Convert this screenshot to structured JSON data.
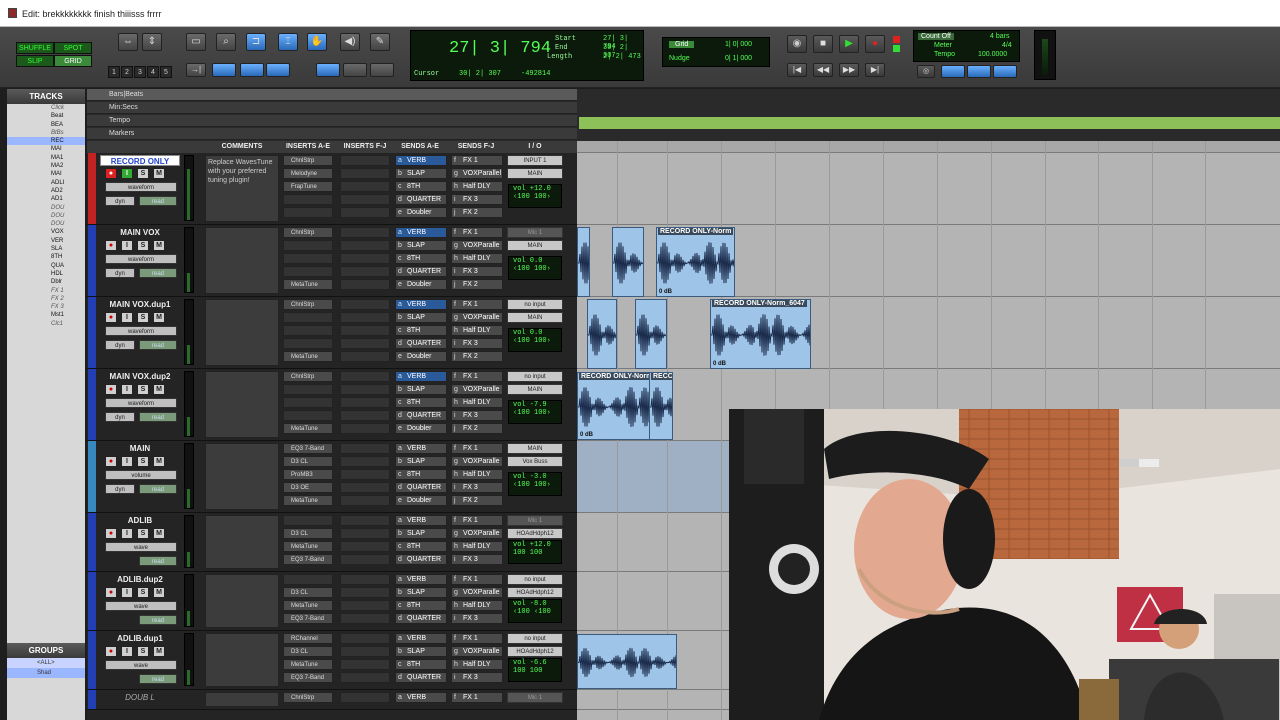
{
  "window": {
    "title": "Edit: brekkkkkkkk finish thiiisss frrrr"
  },
  "edit_modes": [
    "SHUFFLE",
    "SPOT",
    "SLIP",
    "GRID"
  ],
  "zoom_presets": [
    "1",
    "2",
    "3",
    "4",
    "5"
  ],
  "counter": {
    "main": "27| 3| 794",
    "start_label": "Start",
    "start": "27| 3| 794",
    "end_label": "End",
    "end": "30| 2| 307",
    "length_label": "Length",
    "length": "2| 2| 473",
    "cursor_label": "Cursor",
    "cursor": "30| 2| 307",
    "cursor_val2": "-492814"
  },
  "grid": {
    "label": "Grid",
    "value": "1| 0| 000",
    "nudge_label": "Nudge",
    "nudge_value": "0| 1| 000"
  },
  "meter": {
    "count_off": "Count Off",
    "count_bars": "4 bars",
    "meter_label": "Meter",
    "meter": "4/4",
    "tempo_label": "Tempo",
    "tempo": "100.0000"
  },
  "tracks_panel": {
    "title": "TRACKS",
    "items": [
      "Click",
      "Beat",
      "BEA",
      "BtBs",
      "REC",
      "MAI",
      "MA1",
      "MA2",
      "MAI",
      "ADLI",
      "AD2",
      "AD1",
      "DOU",
      "DOU",
      "DOU",
      "VOX",
      "VER",
      "SLA",
      "8TH",
      "QUA",
      "HDL",
      "Dblr",
      "FX 1",
      "FX 2",
      "FX 3",
      "Mst1",
      "Clc1"
    ]
  },
  "groups_panel": {
    "title": "GROUPS",
    "items": [
      "<ALL>",
      "Shad"
    ]
  },
  "rulers": [
    "Bars|Beats",
    "Min:Secs",
    "Tempo",
    "Markers"
  ],
  "mix_columns": [
    "COMMENTS",
    "INSERTS A-E",
    "INSERTS F-J",
    "SENDS A-E",
    "SENDS F-J",
    "I / O"
  ],
  "tracks": [
    {
      "name": "RECORD ONLY",
      "mode": "waveform",
      "sub": "dyn",
      "auto": "read",
      "comment": "Replace WavesTune with your preferred tuning plugin!",
      "inserts": [
        "ChnlStrp",
        "Melodyne",
        "FrapTune",
        "",
        ""
      ],
      "sends_a": [
        [
          "a",
          "VERB"
        ],
        [
          "b",
          "SLAP"
        ],
        [
          "c",
          "8TH"
        ],
        [
          "d",
          "QUARTER"
        ],
        [
          "e",
          "Doubler"
        ]
      ],
      "sends_f": [
        [
          "f",
          "FX 1"
        ],
        [
          "g",
          "VOXParallel"
        ],
        [
          "h",
          "Half DLY"
        ],
        [
          "i",
          "FX 3"
        ],
        [
          "j",
          "FX 2"
        ]
      ],
      "input": "INPUT 1",
      "output": "MAIN",
      "vol": "vol   +12.0",
      "pan": "‹100  100›"
    },
    {
      "name": "MAIN VOX",
      "mode": "waveform",
      "sub": "dyn",
      "auto": "read",
      "comment": "",
      "inserts": [
        "ChnlStrp",
        "",
        "",
        "",
        "MetaTune"
      ],
      "sends_a": [
        [
          "a",
          "VERB"
        ],
        [
          "b",
          "SLAP"
        ],
        [
          "c",
          "8TH"
        ],
        [
          "d",
          "QUARTER"
        ],
        [
          "e",
          "Doubler"
        ]
      ],
      "sends_f": [
        [
          "f",
          "FX 1"
        ],
        [
          "g",
          "VOXParalle"
        ],
        [
          "h",
          "Half DLY"
        ],
        [
          "i",
          "FX 3"
        ],
        [
          "j",
          "FX 2"
        ]
      ],
      "input": "Mic 1",
      "output": "MAIN",
      "vol": "vol    0.0",
      "pan": "‹100  100›"
    },
    {
      "name": "MAIN VOX.dup1",
      "mode": "waveform",
      "sub": "dyn",
      "auto": "read",
      "comment": "",
      "inserts": [
        "ChnlStrp",
        "",
        "",
        "",
        "MetaTune"
      ],
      "sends_a": [
        [
          "a",
          "VERB"
        ],
        [
          "b",
          "SLAP"
        ],
        [
          "c",
          "8TH"
        ],
        [
          "d",
          "QUARTER"
        ],
        [
          "e",
          "Doubler"
        ]
      ],
      "sends_f": [
        [
          "f",
          "FX 1"
        ],
        [
          "g",
          "VOXParalle"
        ],
        [
          "h",
          "Half DLY"
        ],
        [
          "i",
          "FX 3"
        ],
        [
          "j",
          "FX 2"
        ]
      ],
      "input": "no input",
      "output": "MAIN",
      "vol": "vol    0.0",
      "pan": "‹100  100›"
    },
    {
      "name": "MAIN VOX.dup2",
      "mode": "waveform",
      "sub": "dyn",
      "auto": "read",
      "comment": "",
      "inserts": [
        "ChnlStrp",
        "",
        "",
        "",
        "MetaTune"
      ],
      "sends_a": [
        [
          "a",
          "VERB"
        ],
        [
          "b",
          "SLAP"
        ],
        [
          "c",
          "8TH"
        ],
        [
          "d",
          "QUARTER"
        ],
        [
          "e",
          "Doubler"
        ]
      ],
      "sends_f": [
        [
          "f",
          "FX 1"
        ],
        [
          "g",
          "VOXParalle"
        ],
        [
          "h",
          "Half DLY"
        ],
        [
          "i",
          "FX 3"
        ],
        [
          "j",
          "FX 2"
        ]
      ],
      "input": "no input",
      "output": "MAIN",
      "vol": "vol   -7.9",
      "pan": "‹100  100›"
    },
    {
      "name": "MAIN",
      "mode": "volume",
      "sub": "dyn",
      "auto": "read",
      "comment": "",
      "inserts": [
        "EQ3 7-Band",
        "D3 CL",
        "ProMB3",
        "D3 OE",
        "MetaTune"
      ],
      "sends_a": [
        [
          "a",
          "VERB"
        ],
        [
          "b",
          "SLAP"
        ],
        [
          "c",
          "8TH"
        ],
        [
          "d",
          "QUARTER"
        ],
        [
          "e",
          "Doubler"
        ]
      ],
      "sends_f": [
        [
          "f",
          "FX 1"
        ],
        [
          "g",
          "VOXParalle"
        ],
        [
          "h",
          "Half DLY"
        ],
        [
          "i",
          "FX 3"
        ],
        [
          "j",
          "FX 2"
        ]
      ],
      "input": "MAIN",
      "output": "Vox Buss",
      "vol": "vol   -3.0",
      "pan": "‹100  100›"
    },
    {
      "name": "ADLIB",
      "mode": "wave",
      "sub": "",
      "auto": "read",
      "comment": "",
      "inserts": [
        "",
        "D3 CL",
        "MetaTune",
        "EQ3 7-Band"
      ],
      "sends_a": [
        [
          "a",
          "VERB"
        ],
        [
          "b",
          "SLAP"
        ],
        [
          "c",
          "8TH"
        ],
        [
          "d",
          "QUARTER"
        ]
      ],
      "sends_f": [
        [
          "f",
          "FX 1"
        ],
        [
          "g",
          "VOXParalle"
        ],
        [
          "h",
          "Half DLY"
        ],
        [
          "i",
          "FX 3"
        ]
      ],
      "input": "Mic 1",
      "output": "HOAdHdph12",
      "vol": "vol   +12.0",
      "pan": "100  100"
    },
    {
      "name": "ADLIB.dup2",
      "mode": "wave",
      "sub": "",
      "auto": "read",
      "comment": "",
      "inserts": [
        "",
        "D3 CL",
        "MetaTune",
        "EQ3 7-Band"
      ],
      "sends_a": [
        [
          "a",
          "VERB"
        ],
        [
          "b",
          "SLAP"
        ],
        [
          "c",
          "8TH"
        ],
        [
          "d",
          "QUARTER"
        ]
      ],
      "sends_f": [
        [
          "f",
          "FX 1"
        ],
        [
          "g",
          "VOXParalle"
        ],
        [
          "h",
          "Half DLY"
        ],
        [
          "i",
          "FX 3"
        ]
      ],
      "input": "no input",
      "output": "HOAdHdph12",
      "vol": "vol   -8.0",
      "pan": "‹100  ‹100"
    },
    {
      "name": "ADLIB.dup1",
      "mode": "wave",
      "sub": "",
      "auto": "read",
      "comment": "",
      "inserts": [
        "RChannel",
        "D3 CL",
        "MetaTune",
        "EQ3 7-Band"
      ],
      "sends_a": [
        [
          "a",
          "VERB"
        ],
        [
          "b",
          "SLAP"
        ],
        [
          "c",
          "8TH"
        ],
        [
          "d",
          "QUARTER"
        ]
      ],
      "sends_f": [
        [
          "f",
          "FX 1"
        ],
        [
          "g",
          "VOXParalle"
        ],
        [
          "h",
          "Half DLY"
        ],
        [
          "i",
          "FX 3"
        ]
      ],
      "input": "no input",
      "output": "HOAdHdph12",
      "vol": "vol   -6.6",
      "pan": "100  100"
    },
    {
      "name": "DOUB L",
      "mode": "",
      "sub": "",
      "auto": "",
      "comment": "",
      "inserts": [
        "ChnlStrp"
      ],
      "sends_a": [
        [
          "a",
          "VERB"
        ]
      ],
      "sends_f": [
        [
          "f",
          "FX 1"
        ]
      ],
      "input": "Mic 1",
      "output": "",
      "vol": "",
      "pan": ""
    }
  ],
  "clips": [
    {
      "name": "RECORD ONLY-Norm",
      "gain": "0 dB"
    },
    {
      "name": "RECORD ONLY-Norm_6047",
      "gain": "0 dB"
    },
    {
      "name": "RECORD ONLY-Norm",
      "gain": "0 dB"
    },
    {
      "name": "RECC",
      "gain": ""
    }
  ],
  "colors": {
    "accent": "#3a8aff",
    "counter_green": "#55ff55",
    "tempo_ruler": "#8ec05a",
    "clip_fill": "#9ec4e8",
    "record_red": "#dd2222"
  }
}
